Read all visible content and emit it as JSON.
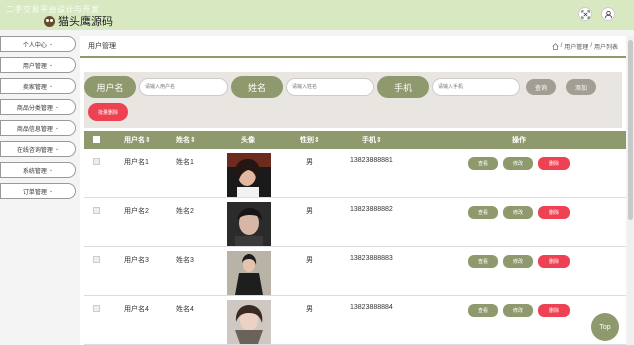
{
  "header": {
    "app_title": "二手交易平台设计与开发",
    "watermark": "猫头鹰源码",
    "icons": [
      "fullscreen-icon",
      "user-icon"
    ]
  },
  "sidebar": {
    "items": [
      {
        "label": "个人中心"
      },
      {
        "label": "用户管理"
      },
      {
        "label": "卖家管理"
      },
      {
        "label": "商品分类管理"
      },
      {
        "label": "商品信息管理"
      },
      {
        "label": "在线咨询管理"
      },
      {
        "label": "系统管理"
      },
      {
        "label": "订单管理"
      }
    ]
  },
  "page": {
    "title": "用户管理",
    "breadcrumb": [
      "用户管理",
      "用户列表"
    ],
    "breadcrumb_sep": "/"
  },
  "search": {
    "fields": [
      {
        "label": "用户名",
        "placeholder": "请输入用户名",
        "value": ""
      },
      {
        "label": "姓名",
        "placeholder": "请输入姓名",
        "value": ""
      },
      {
        "label": "手机",
        "placeholder": "请输入手机",
        "value": ""
      }
    ],
    "query_label": "查询",
    "add_label": "添加",
    "batch_delete_label": "批量删除"
  },
  "table": {
    "columns": [
      "用户名",
      "姓名",
      "头像",
      "性别",
      "手机",
      "操作"
    ],
    "rows": [
      {
        "username": "用户名1",
        "name": "姓名1",
        "gender": "男",
        "phone": "13823888881"
      },
      {
        "username": "用户名2",
        "name": "姓名2",
        "gender": "男",
        "phone": "13823888882"
      },
      {
        "username": "用户名3",
        "name": "姓名3",
        "gender": "男",
        "phone": "13823888883"
      },
      {
        "username": "用户名4",
        "name": "姓名4",
        "gender": "男",
        "phone": "13823888884"
      }
    ],
    "actions": {
      "view": "查看",
      "edit": "修改",
      "delete": "删除"
    }
  },
  "float_top_label": "Top",
  "colors": {
    "accent": "#8e9a6d",
    "danger": "#ee4252",
    "topbar": "#d8e9c2",
    "search_bg": "#e9e6e2",
    "neutral_btn": "#a39e94"
  }
}
